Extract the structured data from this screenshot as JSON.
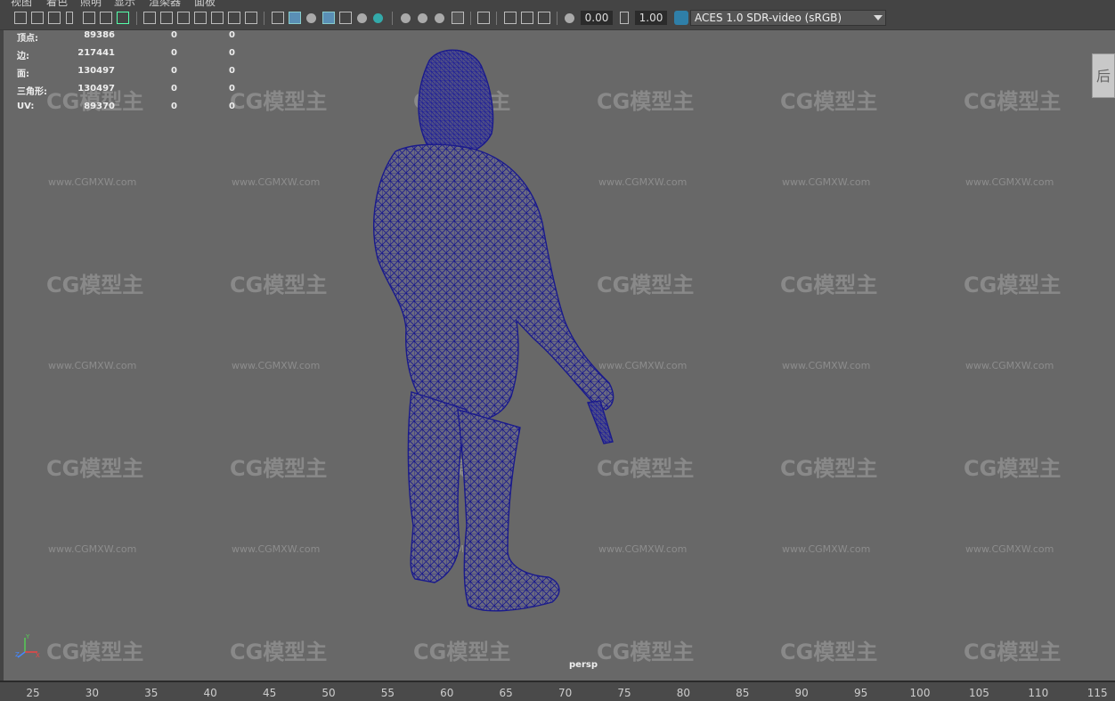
{
  "menu": [
    "视图",
    "着色",
    "照明",
    "显示",
    "渲染器",
    "面板"
  ],
  "toolbar": {
    "exposure_value": "0.00",
    "gamma_value": "1.00",
    "color_management": "ACES 1.0 SDR-video (sRGB)"
  },
  "hud": {
    "rows": [
      {
        "label": "顶点:",
        "v1": "89386",
        "v2": "0",
        "v3": "0"
      },
      {
        "label": "边:",
        "v1": "217441",
        "v2": "0",
        "v3": "0"
      },
      {
        "label": "面:",
        "v1": "130497",
        "v2": "0",
        "v3": "0"
      },
      {
        "label": "三角形:",
        "v1": "130497",
        "v2": "0",
        "v3": "0"
      },
      {
        "label": "UV:",
        "v1": "89370",
        "v2": "0",
        "v3": "0"
      }
    ]
  },
  "viewport": {
    "camera_label": "persp",
    "viewcube_label": "后",
    "axis_labels": [
      "Y",
      "Z",
      "X"
    ]
  },
  "watermark": {
    "logo_text": "CG模型主",
    "url_text": "www.CGMXW.com"
  },
  "timeline": {
    "ticks": [
      "25",
      "30",
      "35",
      "40",
      "45",
      "50",
      "55",
      "60",
      "65",
      "70",
      "75",
      "80",
      "85",
      "90",
      "95",
      "100",
      "105",
      "110",
      "115"
    ]
  },
  "colors": {
    "wireframe": "#1a1a8c",
    "viewport_bg": "#686868",
    "toolbar_bg": "#444444",
    "accent": "#5a8fb5"
  }
}
